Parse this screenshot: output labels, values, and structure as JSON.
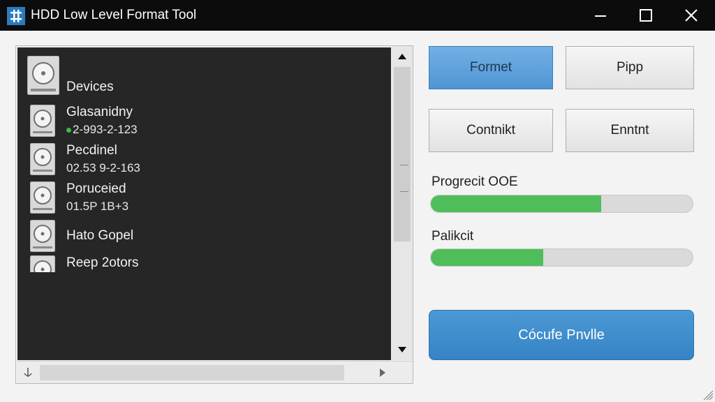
{
  "window": {
    "title": "HDD Low Level Format Tool"
  },
  "device_list": {
    "header": "Devices",
    "devices": [
      {
        "name": "Glasanidny",
        "meta": "2-993-2-123",
        "status_dot": true
      },
      {
        "name": "Pecdinel",
        "meta": "02.53 9-2-163",
        "status_dot": false
      },
      {
        "name": "Poruceied",
        "meta": "01.5P 1B+3",
        "status_dot": false
      },
      {
        "name": "Hato Gopel",
        "meta": "",
        "status_dot": false
      },
      {
        "name": "Reep 2otors",
        "meta": "",
        "status_dot": false
      }
    ]
  },
  "buttons": {
    "format": "Formet",
    "pipp": "Pipp",
    "contrikt": "Contnikt",
    "ennnt": "Enntnt",
    "primary": "Cócufe Pnvlle"
  },
  "progress": [
    {
      "label": "Progrecit OOE",
      "value": 0.65
    },
    {
      "label": "Palikcit",
      "value": 0.43
    }
  ],
  "colors": {
    "accent_blue": "#3584c5",
    "progress_green": "#4fbe5a",
    "list_background": "#262626",
    "titlebar": "#0c0c0c"
  },
  "icons": {
    "app": "format-tool-icon",
    "minimize": "minimize-icon",
    "maximize": "maximize-icon",
    "close": "close-icon",
    "drive": "hard-drive-icon"
  }
}
